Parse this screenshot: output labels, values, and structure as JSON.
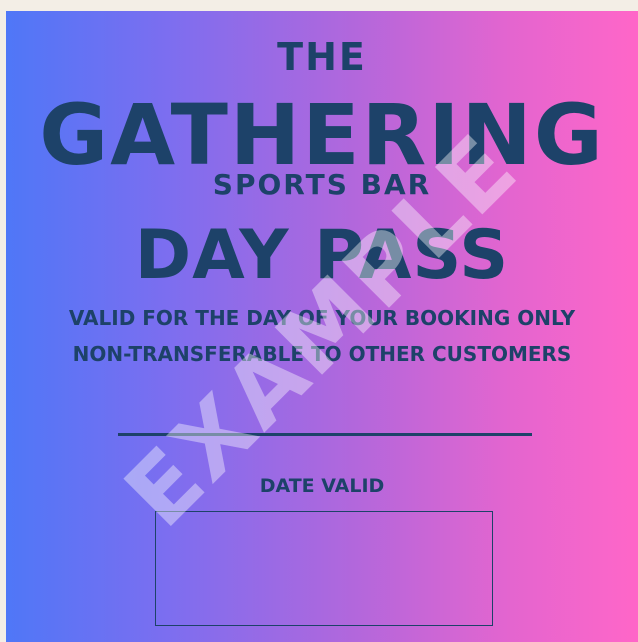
{
  "pass": {
    "the": "THE",
    "name": "GATHERING",
    "subtitle": "SPORTS BAR",
    "title": "DAY PASS",
    "line1": "VALID FOR THE DAY OF YOUR BOOKING ONLY",
    "line2": "NON-TRANSFERABLE TO OTHER CUSTOMERS",
    "date_label": "DATE VALID",
    "watermark": "EXAMPLE"
  },
  "colors": {
    "text": "#1d4269",
    "gradient_left": "#4f77f7",
    "gradient_right": "#ff66c8",
    "background": "#f3eee6"
  }
}
